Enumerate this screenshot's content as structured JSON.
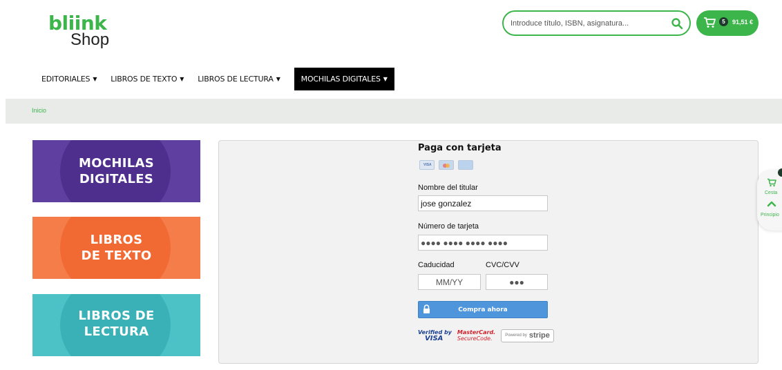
{
  "logo": {
    "brand": "bliink",
    "sub": "Shop"
  },
  "search": {
    "placeholder": "Introduce título, ISBN, asignatura...",
    "icon": "search-icon"
  },
  "cart": {
    "count": "5",
    "total": "91,51 €",
    "icon": "cart-icon"
  },
  "nav": {
    "items": [
      {
        "label": "EDITORIALES"
      },
      {
        "label": "LIBROS DE TEXTO"
      },
      {
        "label": "LIBROS DE LECTURA"
      },
      {
        "label": "MOCHILAS DIGITALES"
      }
    ],
    "caret": "▼"
  },
  "breadcrumb": {
    "home": "Inicio"
  },
  "banners": [
    {
      "line1": "MOCHILAS",
      "line2": "DIGITALES"
    },
    {
      "line1": "LIBROS",
      "line2": "DE TEXTO"
    },
    {
      "line1": "LIBROS DE",
      "line2": "LECTURA"
    }
  ],
  "payment": {
    "title": "Paga con tarjeta",
    "holder_label": "Nombre del titular",
    "holder_value": "jose gonzalez",
    "number_label": "Número de tarjeta",
    "number_placeholder": "●●●● ●●●● ●●●● ●●●●",
    "expiry_label": "Caducidad",
    "expiry_placeholder": "MM/YY",
    "cvc_label": "CVC/CVV",
    "cvc_placeholder": "●●●",
    "buy_label": "Compra ahora",
    "verified_a": "Verified by",
    "verified_b": "VISA",
    "mastercard_a": "MasterCard.",
    "mastercard_b": "SecureCode.",
    "stripe_a": "Powered by",
    "stripe_b": "stripe"
  },
  "float_widget": {
    "cart_label": "Cesta",
    "top_label": "Principio"
  },
  "colors": {
    "brand_green": "#3cb54a",
    "purple": "#5f3fa0",
    "orange": "#f47d4a",
    "teal": "#4dc2c6",
    "button_blue": "#4f95dc"
  }
}
